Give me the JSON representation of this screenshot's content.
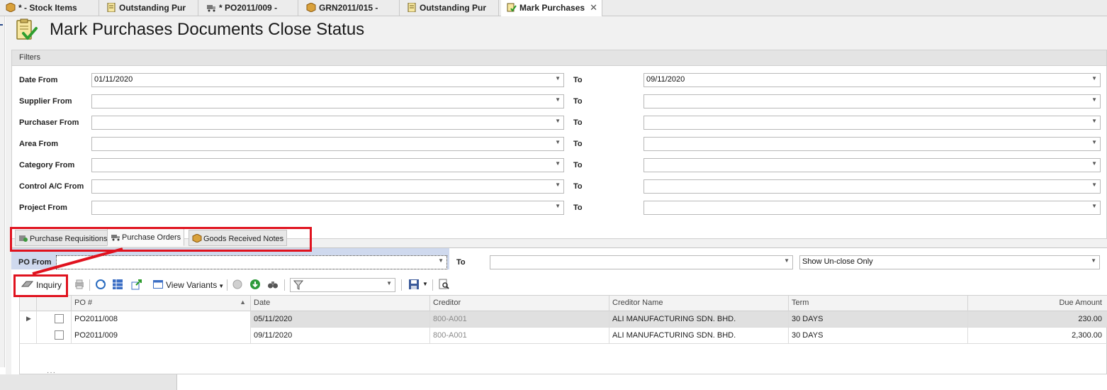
{
  "doc_tabs": [
    {
      "label": "* - Stock Items",
      "icon": "box-icon"
    },
    {
      "label": "Outstanding Pur",
      "icon": "report-icon"
    },
    {
      "label": "* PO2011/009 -",
      "icon": "truck-icon"
    },
    {
      "label": "GRN2011/015 -",
      "icon": "box-icon"
    },
    {
      "label": "Outstanding Pur",
      "icon": "report-icon"
    },
    {
      "label": "Mark Purchases",
      "icon": "check-document-icon"
    }
  ],
  "page": {
    "title": "Mark Purchases Documents Close Status"
  },
  "filters": {
    "header": "Filters",
    "to_label": "To",
    "rows": [
      {
        "label": "Date From",
        "from": "01/11/2020",
        "to": "09/11/2020"
      },
      {
        "label": "Supplier From",
        "from": "",
        "to": ""
      },
      {
        "label": "Purchaser From",
        "from": "",
        "to": ""
      },
      {
        "label": "Area From",
        "from": "",
        "to": ""
      },
      {
        "label": "Category From",
        "from": "",
        "to": ""
      },
      {
        "label": "Control A/C From",
        "from": "",
        "to": ""
      },
      {
        "label": "Project From",
        "from": "",
        "to": ""
      }
    ]
  },
  "doc_type_tabs": [
    {
      "label": "Purchase Requisitions",
      "icon": "requisition-icon"
    },
    {
      "label": "Purchase Orders",
      "icon": "truck-icon",
      "selected": true
    },
    {
      "label": "Goods Received Notes",
      "icon": "box-icon"
    }
  ],
  "po_filter": {
    "from_label": "PO From",
    "from_value": "",
    "to_label": "To",
    "to_value": "",
    "status_value": "Show Un-close Only"
  },
  "toolbar": {
    "inquiry_label": "Inquiry",
    "view_variants_label": "View Variants",
    "filter_value": ""
  },
  "grid": {
    "columns": [
      "PO #",
      "Date",
      "Creditor",
      "Creditor Name",
      "Term",
      "Due Amount"
    ],
    "rows": [
      {
        "po": "PO2011/008",
        "date": "05/11/2020",
        "creditor": "800-A001",
        "name": "ALI MANUFACTURING SDN. BHD.",
        "term": "30 DAYS",
        "amount": "230.00"
      },
      {
        "po": "PO2011/009",
        "date": "09/11/2020",
        "creditor": "800-A001",
        "name": "ALI MANUFACTURING SDN. BHD.",
        "term": "30 DAYS",
        "amount": "2,300.00"
      }
    ]
  },
  "colors": {
    "highlight": "#e0121e",
    "selection": "#cfd9ee"
  }
}
